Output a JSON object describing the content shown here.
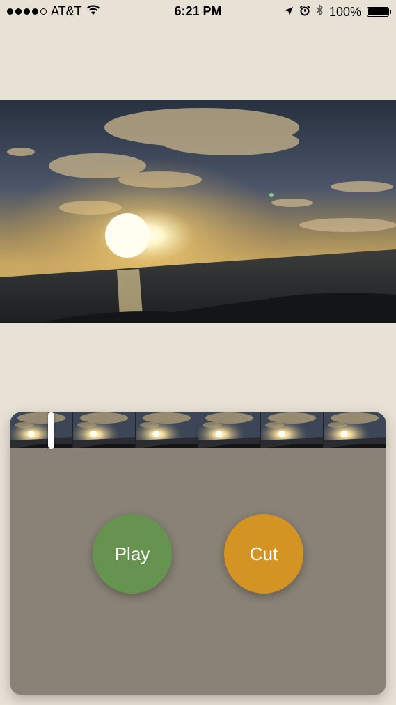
{
  "status_bar": {
    "carrier": "AT&T",
    "time": "6:21 PM",
    "battery": "100%",
    "battery_level": 1.0,
    "signal_bars": 4
  },
  "video": {
    "scene": "sunset-over-ocean"
  },
  "timeline": {
    "frame_count": 6,
    "playhead_position": 0.1
  },
  "controls": {
    "play_label": "Play",
    "cut_label": "Cut",
    "play_color": "#669450",
    "cut_color": "#d49424"
  },
  "colors": {
    "background": "#e8e1d6",
    "panel": "#898276"
  }
}
